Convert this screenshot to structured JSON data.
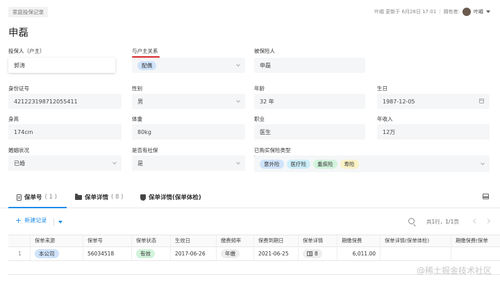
{
  "header": {
    "tag": "家庭投保记录",
    "updated_text": "叶峨 更新于 6月28日 17:01",
    "owner_label": "拥有者:",
    "owner_name": "叶峨"
  },
  "record_title": "申磊",
  "fields": {
    "policyholder": {
      "label": "投保人（户主）",
      "value": "郭涛"
    },
    "relation": {
      "label": "与户主关系",
      "value": "配偶",
      "pill_color": "#cfe3fb"
    },
    "insured": {
      "label": "被保险人",
      "value": "申磊"
    },
    "id_number": {
      "label": "身份证号",
      "value": "421223198712055411"
    },
    "gender": {
      "label": "性别",
      "value": "男"
    },
    "age": {
      "label": "年龄",
      "value": "32 年"
    },
    "birthday": {
      "label": "生日",
      "value": "1987-12-05"
    },
    "height": {
      "label": "身高",
      "value": "174cm"
    },
    "weight": {
      "label": "体重",
      "value": "80kg"
    },
    "occupation": {
      "label": "职业",
      "value": "医生"
    },
    "income": {
      "label": "年收入",
      "value": "12万"
    },
    "marital": {
      "label": "婚姻状况",
      "value": "已婚"
    },
    "social_insurance": {
      "label": "是否有社保",
      "value": "是"
    },
    "insurance_types": {
      "label": "已购买保险类型",
      "values": [
        {
          "text": "意外险",
          "color": "#cfe3fb"
        },
        {
          "text": "医疗险",
          "color": "#cdeefb"
        },
        {
          "text": "重疾险",
          "color": "#d2f3dc"
        },
        {
          "text": "寿险",
          "color": "#fbf2c6"
        }
      ]
    }
  },
  "tabs": [
    {
      "label": "保单号",
      "count": "( 1 )"
    },
    {
      "label": "保单详情",
      "count": "( 8 )"
    },
    {
      "label": "保单详情(保单体检)",
      "count": ""
    }
  ],
  "toolbar": {
    "new_label": "新建记录",
    "pager_text": "共1行，1/1页"
  },
  "table": {
    "headers": [
      "保单来源",
      "保单号",
      "保单状态",
      "生效日",
      "缴费频率",
      "保费到期日",
      "保单详情",
      "期缴保费",
      "保单详情(保单体检)",
      "期缴保费(保单"
    ],
    "rows": [
      {
        "index": "1",
        "source": "本公司",
        "source_color": "#cfe3fb",
        "policy_no": "56034518",
        "status": "有效",
        "status_color": "#d2f3dc",
        "effective_date": "2017-06-26",
        "frequency": "年缴",
        "frequency_color": "#eeeeee",
        "due_date": "2021-06-25",
        "details_count": "8",
        "premium": "6,011.00"
      }
    ]
  },
  "watermark": "@稀土掘金技术社区"
}
